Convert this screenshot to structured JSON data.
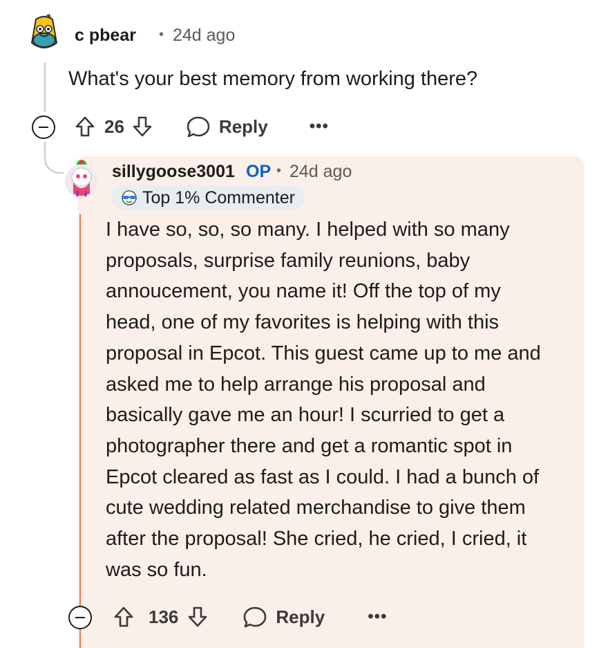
{
  "parent_comment": {
    "username": "c pbear",
    "time": "24d ago",
    "body": "What's your best memory from working there?",
    "votes": "26",
    "reply_label": "Reply",
    "more_label": "•••"
  },
  "reply_comment": {
    "username": "sillygoose3001",
    "op_badge": "OP",
    "time": "24d ago",
    "flair": "Top 1% Commenter",
    "body_lines": [
      "I have so, so, so many. I helped with so many",
      "proposals, surprise family reunions, baby",
      "annoucement, you name it! Off the top of my",
      "head, one of my favorites is helping with this",
      "proposal in Epcot. This guest came up to me and",
      "asked me to help arrange his proposal and",
      "basically gave me an hour! I scurried to get a",
      "photographer there and get a romantic spot in",
      "Epcot cleared as fast as I could. I had a bunch of",
      "cute wedding related merchandise to give them",
      "after the proposal! She cried, he cried, I cried, it",
      "was so fun."
    ],
    "votes": "136",
    "reply_label": "Reply",
    "more_label": "•••"
  },
  "separator": "•",
  "colors": {
    "op": "#0e5fc9",
    "highlight_bg": "#fbefe9",
    "highlight_bar": "#e8794f"
  }
}
